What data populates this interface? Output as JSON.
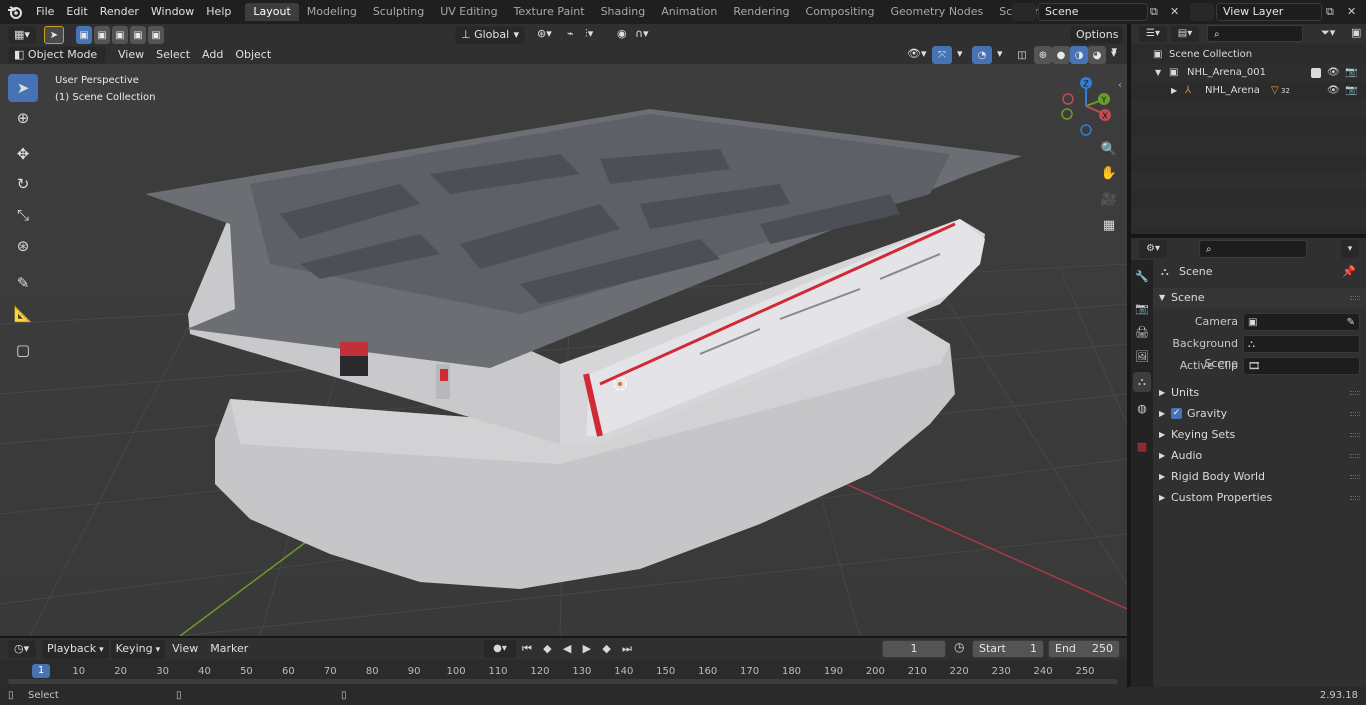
{
  "menu": [
    "File",
    "Edit",
    "Render",
    "Window",
    "Help"
  ],
  "workspaces": [
    {
      "label": "Layout",
      "active": true
    },
    {
      "label": "Modeling"
    },
    {
      "label": "Sculpting"
    },
    {
      "label": "UV Editing"
    },
    {
      "label": "Texture Paint"
    },
    {
      "label": "Shading"
    },
    {
      "label": "Animation"
    },
    {
      "label": "Rendering"
    },
    {
      "label": "Compositing"
    },
    {
      "label": "Geometry Nodes"
    },
    {
      "label": "Scripting"
    }
  ],
  "add_workspace": "+",
  "scene_name": "Scene",
  "view_layer_name": "View Layer",
  "viewport": {
    "mode": "Object Mode",
    "menus": [
      "View",
      "Select",
      "Add",
      "Object"
    ],
    "transform_orientation": "Global",
    "options_label": "Options",
    "perspective_label": "User Perspective",
    "collection_label": "(1) Scene Collection",
    "gizmo_axes": [
      "Y",
      "Z",
      "X"
    ],
    "colors": {
      "x_axis": "#c24a52",
      "y_axis": "#6c9a2b",
      "z_axis": "#2f7fd6",
      "accent": "#4772b3"
    }
  },
  "outliner": {
    "search_placeholder": "",
    "root": "Scene Collection",
    "collection": "NHL_Arena_001",
    "object": "NHL_Arena",
    "object_badge": "32"
  },
  "properties": {
    "search_placeholder": "",
    "context": "Scene",
    "section": "Scene",
    "fields": [
      {
        "label": "Camera",
        "icon": "camera-object-icon"
      },
      {
        "label": "Background Scene",
        "icon": "scene-icon"
      },
      {
        "label": "Active Clip",
        "icon": "clip-icon"
      }
    ],
    "panels": [
      {
        "label": "Units"
      },
      {
        "label": "Gravity",
        "checkbox": true
      },
      {
        "label": "Keying Sets"
      },
      {
        "label": "Audio"
      },
      {
        "label": "Rigid Body World"
      },
      {
        "label": "Custom Properties"
      }
    ]
  },
  "timeline": {
    "menus": [
      "Playback",
      "Keying",
      "View",
      "Marker"
    ],
    "current_frame": "1",
    "start_label": "Start",
    "start_value": "1",
    "end_label": "End",
    "end_value": "250",
    "ticks": [
      "1",
      "10",
      "20",
      "30",
      "40",
      "50",
      "60",
      "70",
      "80",
      "90",
      "100",
      "110",
      "120",
      "130",
      "140",
      "150",
      "160",
      "170",
      "180",
      "190",
      "200",
      "210",
      "220",
      "230",
      "240",
      "250"
    ]
  },
  "status": {
    "select_label": "Select",
    "version": "2.93.18"
  }
}
